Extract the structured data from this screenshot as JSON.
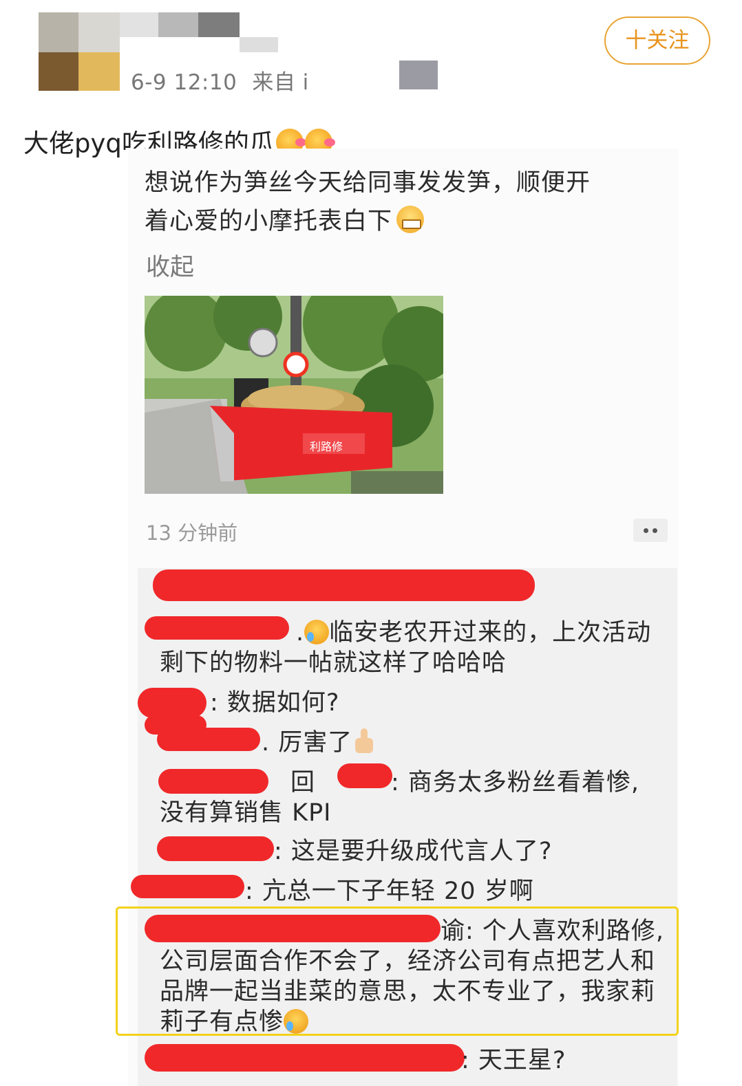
{
  "header": {
    "meta_time": "6-9 12:10",
    "meta_source": "来自 i",
    "follow_label": "十关注"
  },
  "post": {
    "text": "大佬pyq吃利路修的瓜",
    "emoji_icons": [
      "drooling-face-icon",
      "drooling-face-icon"
    ]
  },
  "moment": {
    "text_line1": "想说作为笋丝今天给同事发发笋，顺便开",
    "text_line2": "着心爱的小摩托表白下",
    "collapse_label": "收起",
    "photo_brand": "利路修",
    "time_ago": "13 分钟前"
  },
  "comments": [
    {
      "text_a": ".",
      "text_b": "临安老农开过来的，上次活动",
      "text_c": "剩下的物料一帖就这样了哈哈哈"
    },
    {
      "text": ": 数据如何?"
    },
    {
      "text": ". 厉害了"
    },
    {
      "text_pre": "回",
      "text_mid": ": 商务太多粉丝看着惨,",
      "text_c": "没有算销售 KPI"
    },
    {
      "text": ": 这是要升级成代言人了?"
    },
    {
      "text": ": 亢总一下子年轻 20 岁啊"
    },
    {
      "text_a": "谕: 个人喜欢利路修,",
      "text_b": "公司层面合作不会了，经济公司有点把艺人和",
      "text_c": "品牌一起当韭菜的意思，太不专业了，我家莉",
      "text_d": "莉子有点惨"
    },
    {
      "text": ": 天王星?"
    }
  ],
  "colors": {
    "follow_accent": "#e8a432",
    "redaction": "#f0282a",
    "highlight_border": "#f3d21a"
  }
}
